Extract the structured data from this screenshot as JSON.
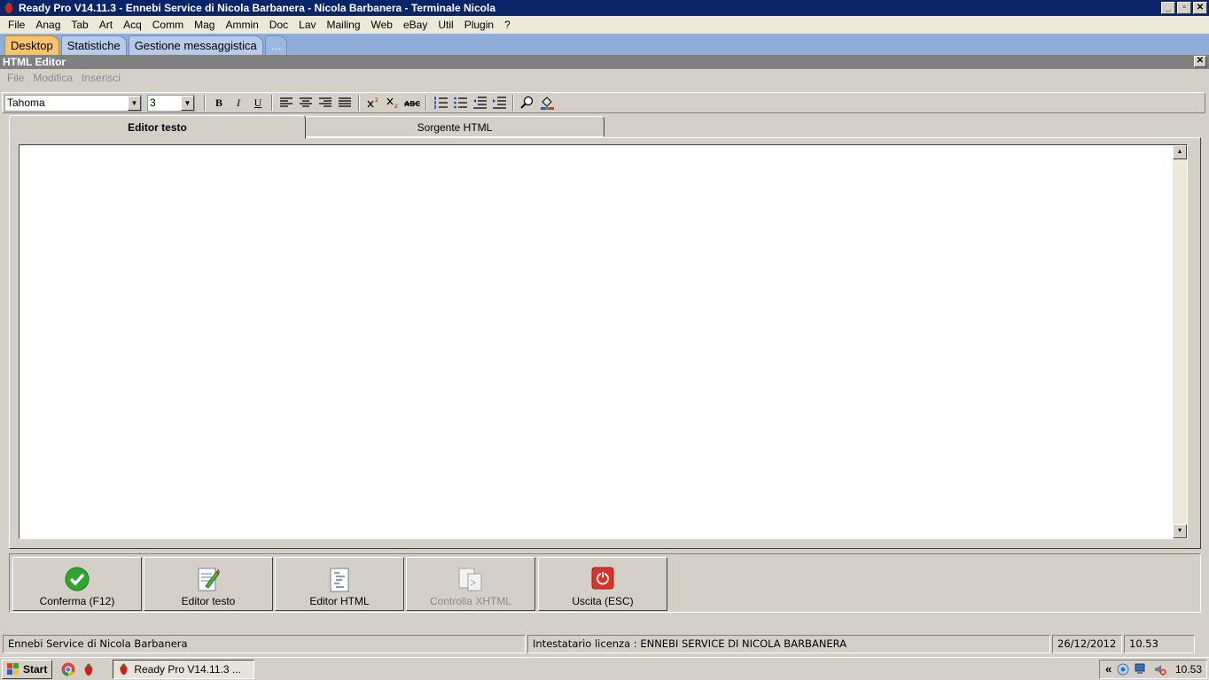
{
  "window": {
    "title": "Ready Pro V14.11.3 - Ennebi Service di Nicola Barbanera - Nicola Barbanera - Terminale Nicola",
    "minimize": "_",
    "maximize": "▫",
    "close": "✕"
  },
  "menubar": [
    "File",
    "Anag",
    "Tab",
    "Art",
    "Acq",
    "Comm",
    "Mag",
    "Ammin",
    "Doc",
    "Lav",
    "Mailing",
    "Web",
    "eBay",
    "Util",
    "Plugin",
    "?"
  ],
  "desktop_tabs": [
    {
      "label": "Desktop",
      "active": true
    },
    {
      "label": "Statistiche",
      "active": false
    },
    {
      "label": "Gestione messaggistica",
      "active": false
    },
    {
      "label": "...",
      "active": false
    }
  ],
  "editor": {
    "title": "HTML Editor",
    "close": "✕",
    "menu": [
      "File",
      "Modifica",
      "Inserisci"
    ],
    "font_value": "Tahoma",
    "size_value": "3",
    "toolbar": {
      "bold": "B",
      "italic": "I",
      "underline": "U"
    },
    "tabs": {
      "text": "Editor testo",
      "source": "Sorgente HTML"
    }
  },
  "buttons": [
    {
      "label": "Conferma (F12)",
      "icon": "check-icon",
      "enabled": true
    },
    {
      "label": "Editor testo",
      "icon": "edit-document-icon",
      "enabled": true
    },
    {
      "label": "Editor HTML",
      "icon": "html-document-icon",
      "enabled": true
    },
    {
      "label": "Controlla XHTML",
      "icon": "check-xhtml-icon",
      "enabled": false
    },
    {
      "label": "Uscita (ESC)",
      "icon": "power-icon",
      "enabled": true
    }
  ],
  "status": {
    "company": "Ennebi Service di Nicola Barbanera",
    "license": "Intestatario licenza : ENNEBI SERVICE DI NICOLA BARBANERA",
    "date": "26/12/2012",
    "time": "10.53"
  },
  "taskbar": {
    "start": "Start",
    "task": "Ready Pro V14.11.3 ...",
    "clock": "10.53",
    "tray_expand": "«"
  },
  "colors": {
    "titlebar": "#0a246a",
    "tab_active": "#f6c36e",
    "tabstrip": "#8eadd9",
    "confirm_green": "#2fa52f",
    "exit_red": "#d9342b"
  }
}
